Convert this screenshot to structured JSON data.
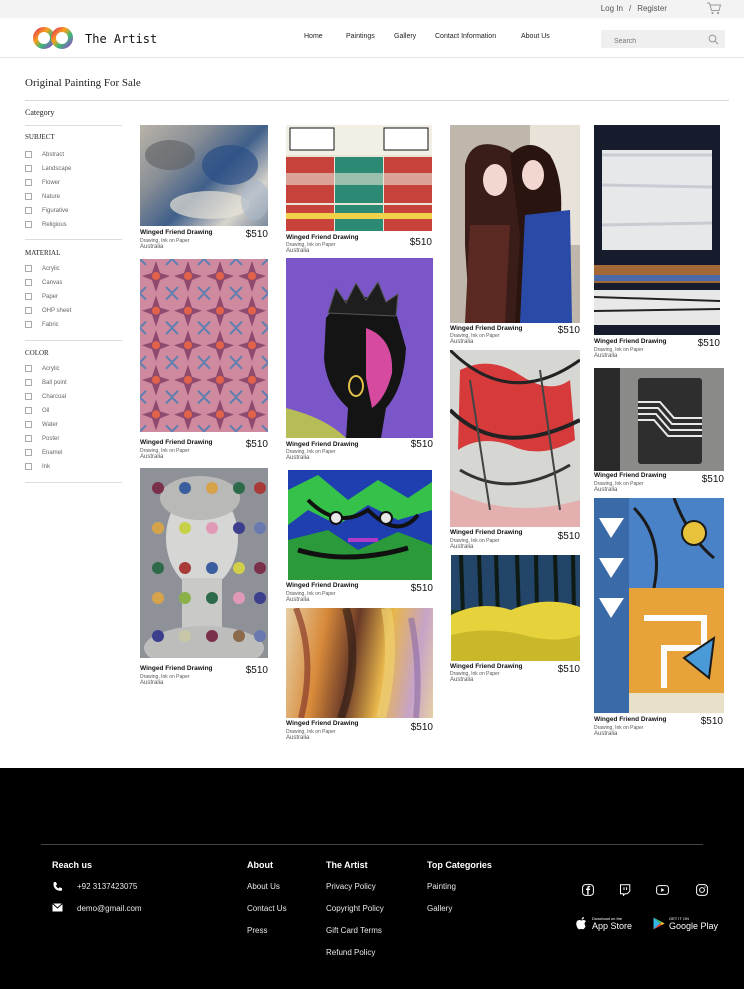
{
  "topbar": {
    "login": "Log In",
    "separator": "/",
    "register": "Register"
  },
  "header": {
    "brand": "The Artist",
    "nav": [
      "Home",
      "Paintings",
      "Gallery",
      "Contact Information",
      "About Us"
    ],
    "search_placeholder": "Search"
  },
  "page": {
    "title": "Original Painting For Sale"
  },
  "sidebar": {
    "category": "Category",
    "subject": {
      "heading": "SUBJECT",
      "options": [
        "Abstract",
        "Landscape",
        "Flower",
        "Nature",
        "Figurative",
        "Religious"
      ]
    },
    "material": {
      "heading": "MATERIAL",
      "options": [
        "Acrylic",
        "Canvas",
        "Paper",
        "OHP sheet",
        "Fabric"
      ]
    },
    "color": {
      "heading": "COLOR",
      "options": [
        "Acrylic",
        "Ball point",
        "Charcoal",
        "Oil",
        "Water",
        "Poster",
        "Enamel",
        "Ink"
      ]
    }
  },
  "artworks": [
    {
      "title": "Winged Friend Drawing",
      "medium": "Drawing, Ink on Paper",
      "location": "Australia",
      "price": "$510"
    },
    {
      "title": "Winged Friend Drawing",
      "medium": "Drawing, Ink on Paper",
      "location": "Australia",
      "price": "$510"
    },
    {
      "title": "Winged Friend Drawing",
      "medium": "Drawing, Ink on Paper",
      "location": "Australia",
      "price": "$510"
    },
    {
      "title": "Winged Friend Drawing",
      "medium": "Drawing, Ink on Paper",
      "location": "Australia",
      "price": "$510"
    },
    {
      "title": "Winged Friend Drawing",
      "medium": "Drawing, Ink on Paper",
      "location": "Australia",
      "price": "$510"
    },
    {
      "title": "Winged Friend Drawing",
      "medium": "Drawing, Ink on Paper",
      "location": "Australia",
      "price": "$510"
    },
    {
      "title": "Winged Friend Drawing",
      "medium": "Drawing, Ink on Paper",
      "location": "Australia",
      "price": "$510"
    },
    {
      "title": "Winged Friend Drawing",
      "medium": "Drawing, Ink on Paper",
      "location": "Australia",
      "price": "$510"
    },
    {
      "title": "Winged Friend Drawing",
      "medium": "Drawing, Ink on Paper",
      "location": "Australia",
      "price": "$510"
    },
    {
      "title": "Winged Friend Drawing",
      "medium": "Drawing, Ink on Paper",
      "location": "Australia",
      "price": "$510"
    },
    {
      "title": "Winged Friend Drawing",
      "medium": "Drawing, Ink on Paper",
      "location": "Australia",
      "price": "$510"
    },
    {
      "title": "Winged Friend Drawing",
      "medium": "Drawing, Ink on Paper",
      "location": "Australia",
      "price": "$510"
    },
    {
      "title": "Winged Friend Drawing",
      "medium": "Drawing, Ink on Paper",
      "location": "Australia",
      "price": "$510"
    }
  ],
  "footer": {
    "reach_us": "Reach us",
    "phone": "+92 3137423075",
    "email": "demo@gmail.com",
    "about": {
      "heading": "About",
      "links": [
        "About Us",
        "Contact Us",
        "Press"
      ]
    },
    "the_artist": {
      "heading": "The Artist",
      "links": [
        "Privacy Policy",
        "Copyright Policy",
        "Gift Card Terms",
        "Refund Policy"
      ]
    },
    "top_categories": {
      "heading": "Top Categories",
      "links": [
        "Painting",
        "Gallery"
      ]
    },
    "social_icons": [
      "facebook-icon",
      "twitch-icon",
      "youtube-icon",
      "instagram-icon"
    ],
    "app_store": {
      "small": "Download on the",
      "large": "App Store"
    },
    "google_play": {
      "small": "GET IT ON",
      "large": "Google Play"
    }
  }
}
